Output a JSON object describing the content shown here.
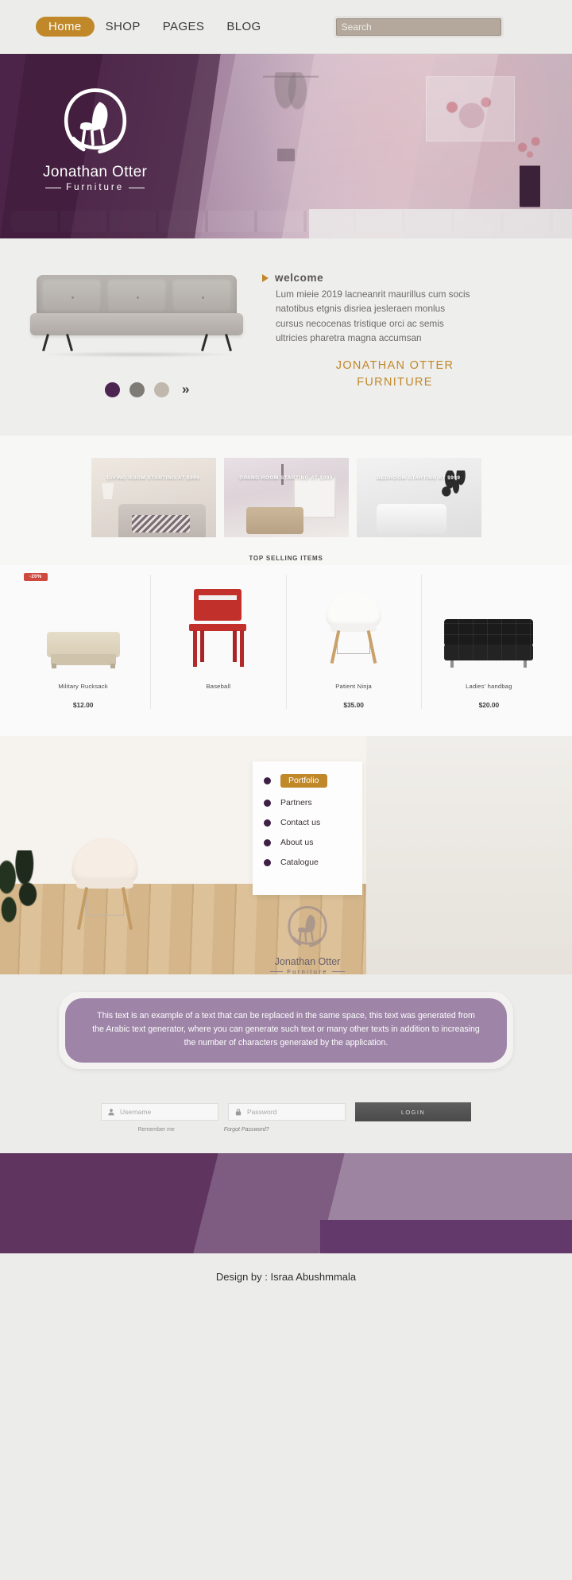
{
  "nav": {
    "items": [
      {
        "label": "Home",
        "active": true
      },
      {
        "label": "SHOP",
        "active": false
      },
      {
        "label": "PAGES",
        "active": false
      },
      {
        "label": "BLOG",
        "active": false
      }
    ],
    "search_placeholder": "Search",
    "search_value": ""
  },
  "hero": {
    "logo_name": "Jonathan Otter",
    "logo_sub": "Furniture"
  },
  "welcome": {
    "eyebrow": "welcome",
    "body": "Lum mieie 2019 lacneanrit maurillus cum socis natotibus etgnis disriea jesleraen monlus cursus necocenas tristique orci ac semis ultricies pharetra magna accumsan",
    "title_line1": "JONATHAN OTTER",
    "title_line2": "FURNITURE",
    "next_glyph": "»",
    "dots": [
      {
        "name": "slide-1",
        "color": "#4b2450",
        "active": true
      },
      {
        "name": "slide-2",
        "color": "#7e7a76",
        "active": false
      },
      {
        "name": "slide-3",
        "color": "#c0b8ad",
        "active": false
      }
    ]
  },
  "categories": [
    {
      "label": "LIVING ROOM STARTING AT $999"
    },
    {
      "label": "DINING ROOM STARTING AT $999"
    },
    {
      "label": "BEDROOM STARTING AT $999"
    }
  ],
  "top_selling": {
    "heading": "TOP SELLING ITEMS",
    "products": [
      {
        "name": "Military Rucksack",
        "price": "$12.00",
        "badge": "-20%"
      },
      {
        "name": "Baseball",
        "price": "",
        "badge": ""
      },
      {
        "name": "Patient Ninja",
        "price": "$35.00",
        "badge": ""
      },
      {
        "name": "Ladies' handbag",
        "price": "$20.00",
        "badge": ""
      }
    ]
  },
  "portfolio_menu": {
    "items": [
      {
        "label": "Portfolio",
        "active": true
      },
      {
        "label": "Partners",
        "active": false
      },
      {
        "label": "Contact us",
        "active": false
      },
      {
        "label": "About us",
        "active": false
      },
      {
        "label": "Catalogue",
        "active": false
      }
    ],
    "logo_name": "Jonathan Otter",
    "logo_sub": "Furniture"
  },
  "text_banner": {
    "text": "This text is an example of a text that can be replaced in the same space, this text was generated from the Arabic text generator, where you can generate such text or many other texts in addition to increasing the number of characters generated by the application."
  },
  "login": {
    "username_placeholder": "Username",
    "username_value": "",
    "password_placeholder": "Password",
    "password_value": "",
    "button_label": "LOGIN",
    "remember_label": "Remember me",
    "forgot_label": "Forgot Password?"
  },
  "footer": {
    "credit": "Design by : Israa Abushmmala"
  },
  "colors": {
    "accent_gold": "#c08829",
    "brand_purple": "#4b2450",
    "banner_purple": "#9e85a8",
    "badge_red": "#cf4a3e"
  }
}
